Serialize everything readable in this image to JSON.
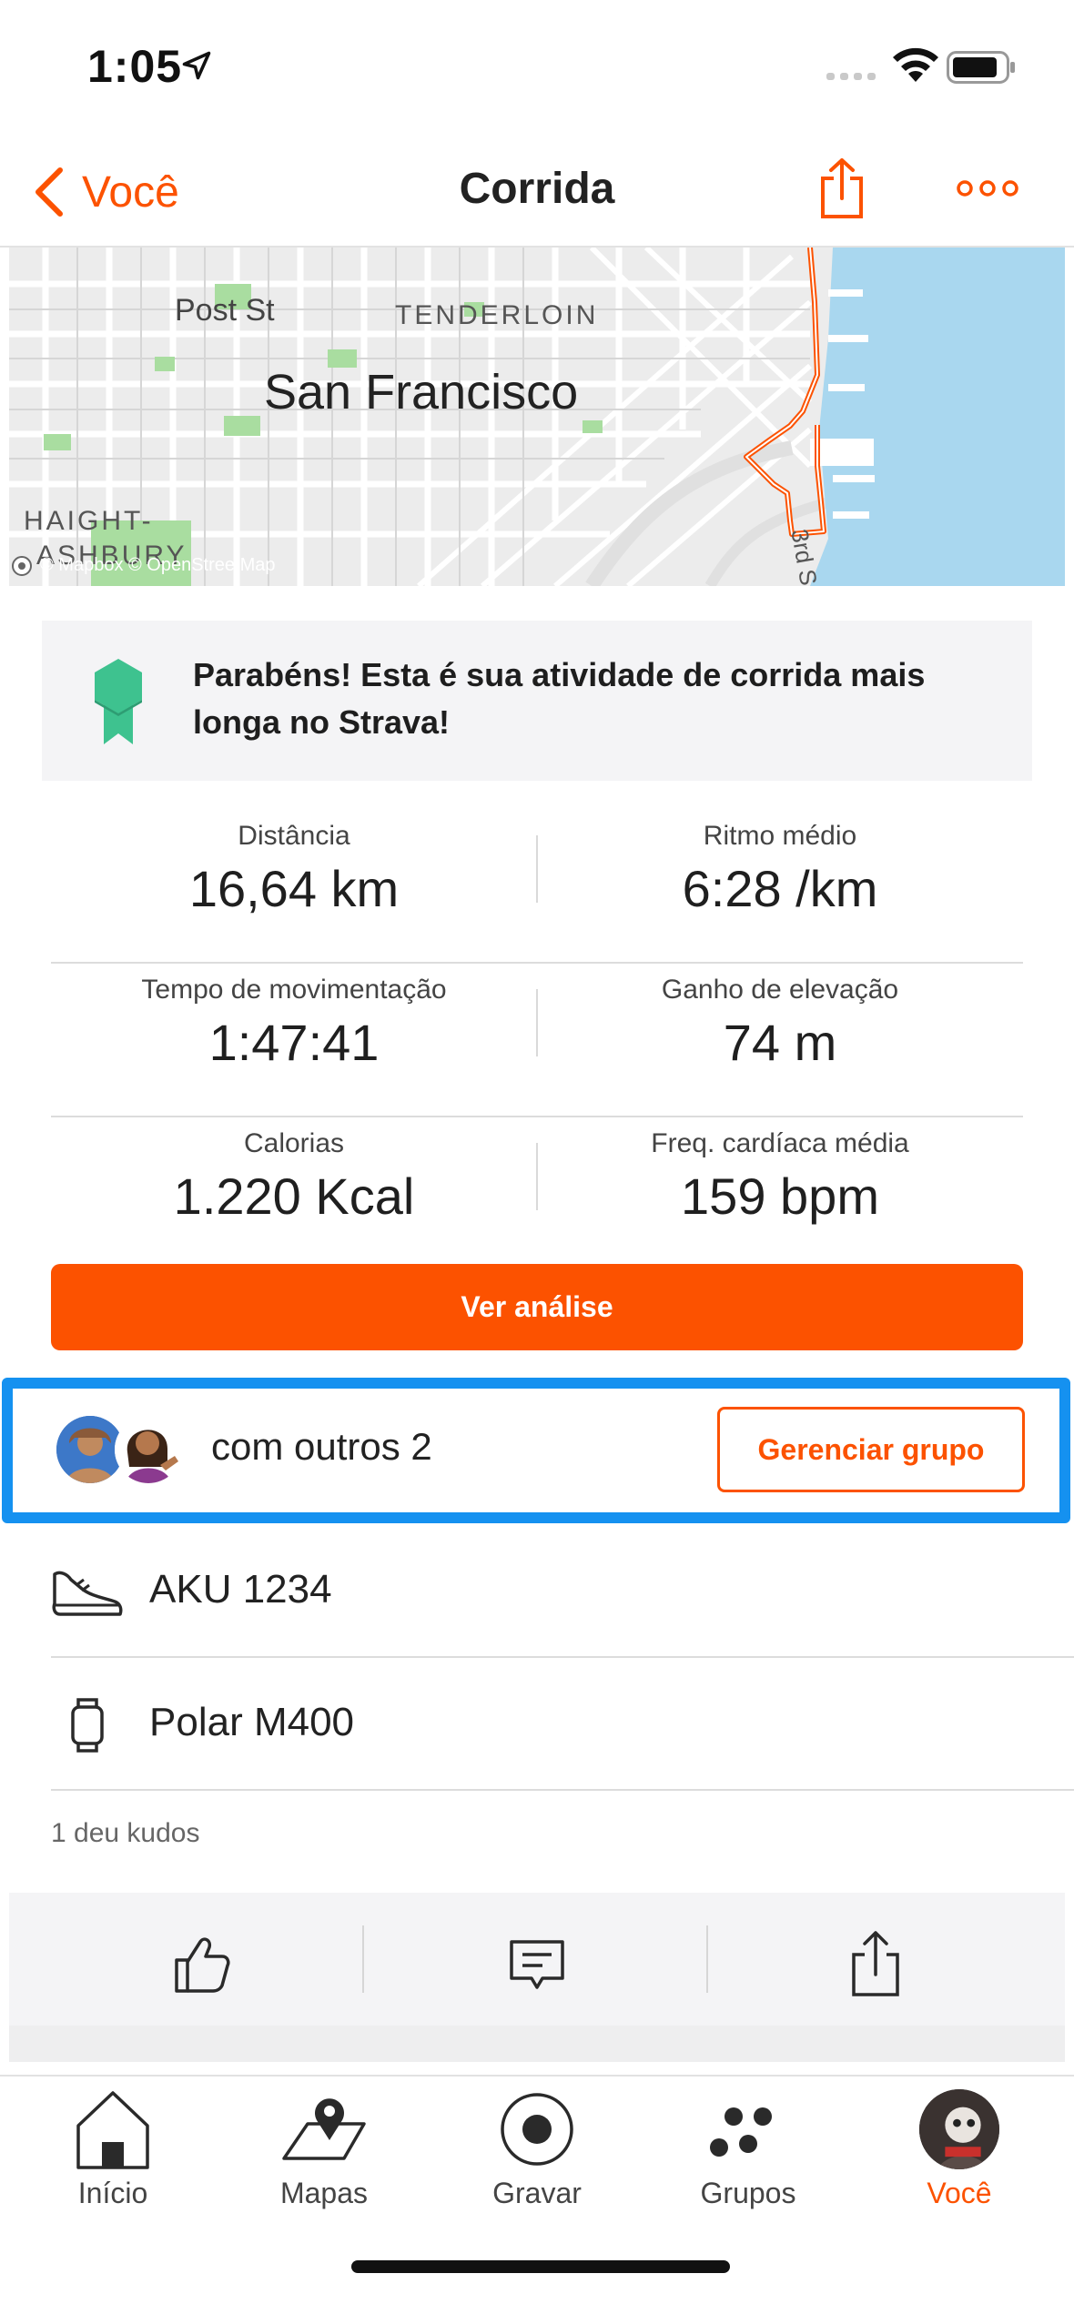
{
  "status_bar": {
    "time": "1:05"
  },
  "nav": {
    "back_label": "Você",
    "title": "Corrida"
  },
  "map": {
    "labels": {
      "post_st": "Post St",
      "tenderloin": "TENDERLOIN",
      "city": "San Francisco",
      "haight_1": "HAIGHT-",
      "haight_2": "ASHBURY",
      "third_st": "3rd S",
      "credit": "© Mapbox © OpenStreetMap"
    },
    "route_color": "#fc5200",
    "water_color": "#a9d7ef"
  },
  "achievement": {
    "text": "Parabéns! Esta é sua atividade de corrida mais longa no Strava!"
  },
  "stats": [
    {
      "left_label": "Distância",
      "left_value": "16,64 km",
      "right_label": "Ritmo médio",
      "right_value": "6:28 /km"
    },
    {
      "left_label": "Tempo de movimentação",
      "left_value": "1:47:41",
      "right_label": "Ganho de elevação",
      "right_value": "74 m"
    },
    {
      "left_label": "Calorias",
      "left_value": "1.220 Kcal",
      "right_label": "Freq. cardíaca média",
      "right_value": "159 bpm"
    }
  ],
  "analysis_button": "Ver análise",
  "group": {
    "text": "com outros 2",
    "manage_label": "Gerenciar grupo"
  },
  "gear": [
    {
      "name": "AKU 1234",
      "icon": "shoe-icon"
    },
    {
      "name": "Polar M400",
      "icon": "watch-icon"
    }
  ],
  "kudos_text": "1 deu kudos",
  "tabs": [
    {
      "label": "Início",
      "icon": "home-icon"
    },
    {
      "label": "Mapas",
      "icon": "map-icon"
    },
    {
      "label": "Gravar",
      "icon": "record-icon"
    },
    {
      "label": "Grupos",
      "icon": "groups-icon"
    },
    {
      "label": "Você",
      "icon": "profile-avatar"
    }
  ],
  "colors": {
    "accent": "#fc5200",
    "highlight": "#1591f0",
    "achievement_green": "#3ec28f"
  }
}
